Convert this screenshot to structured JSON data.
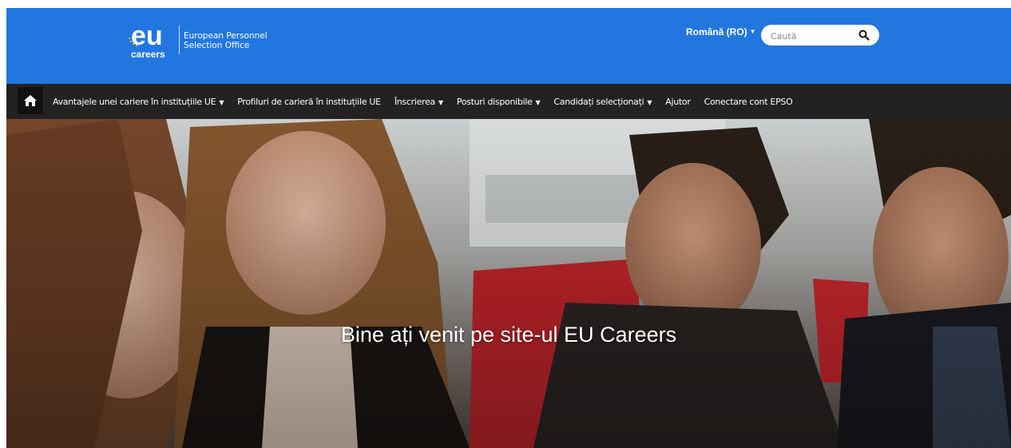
{
  "header": {
    "logo_text": "careers",
    "logo_mark": "eu",
    "agency_line1": "European Personnel",
    "agency_line2": "Selection Office",
    "language": "Română (RO)",
    "search_placeholder": "Caută",
    "brand_color": "#2276e0"
  },
  "nav": {
    "home_icon": "home-icon",
    "items": [
      {
        "label": "Avantajele unei cariere în instituțiile UE",
        "dropdown": true
      },
      {
        "label": "Profiluri de carieră în instituțiile UE",
        "dropdown": false
      },
      {
        "label": "Înscrierea",
        "dropdown": true
      },
      {
        "label": "Posturi disponibile",
        "dropdown": true
      },
      {
        "label": "Candidați selecționați",
        "dropdown": true
      },
      {
        "label": "Ajutor",
        "dropdown": false
      },
      {
        "label": "Conectare cont EPSO",
        "dropdown": false
      }
    ],
    "background": "#222222"
  },
  "hero": {
    "title": "Bine ați venit pe site-ul EU Careers"
  }
}
